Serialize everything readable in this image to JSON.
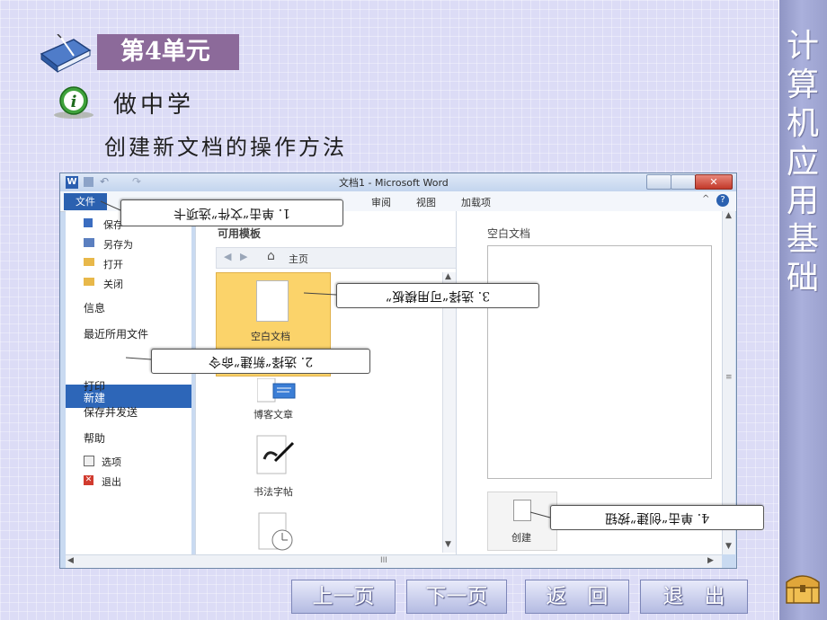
{
  "sidebar": {
    "title": "计算机应用基础"
  },
  "slide": {
    "unit_label": "第4单元",
    "subheading": "做中学",
    "section_title": "创建新文档的操作方法"
  },
  "word": {
    "window_title": "文档1 - Microsoft Word",
    "file_tab": "文件",
    "ribbon_tabs": [
      "审阅",
      "视图",
      "加载项"
    ],
    "left_nav": {
      "save": "保存",
      "save_as": "另存为",
      "open": "打开",
      "close": "关闭",
      "info": "信息",
      "recent": "最近所用文件",
      "new": "新建",
      "print": "打印",
      "save_send": "保存并发送",
      "help": "帮助",
      "options": "选项",
      "exit": "退出"
    },
    "center": {
      "header": "可用模板",
      "home": "主页",
      "templates": [
        "空白文档",
        "博客文章",
        "书法字帖"
      ]
    },
    "right": {
      "header": "空白文档",
      "create_button": "创建"
    },
    "scroll_marker": "III"
  },
  "callouts": {
    "c1": "1. 单击“文件”选项卡",
    "c2": "2. 选择“新建”命令",
    "c3": "3. 选择“可用模板”",
    "c4": "4. 单击“创建”按钮"
  },
  "nav_buttons": {
    "prev": "上一页",
    "next": "下一页",
    "back": "返　回",
    "exit": "退　出"
  },
  "colors": {
    "slide_bg": "#dcdcf6",
    "unit_box": "#8c6a9a",
    "sidebar": "#9aa0cd",
    "file_tab": "#2b61b0",
    "selected_template": "#fbd36a"
  }
}
